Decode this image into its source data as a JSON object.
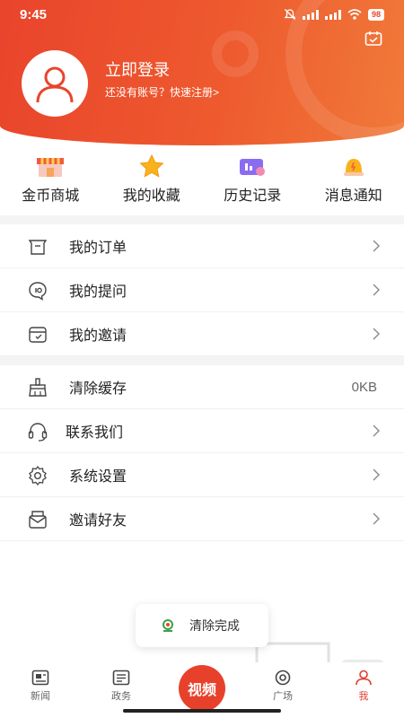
{
  "status_bar": {
    "time": "9:45",
    "battery": "98"
  },
  "profile": {
    "title": "立即登录",
    "subtitle": "还没有账号？快速注册>"
  },
  "quick_menu": [
    {
      "label": "金币商城",
      "icon": "shop-icon"
    },
    {
      "label": "我的收藏",
      "icon": "star-icon"
    },
    {
      "label": "历史记录",
      "icon": "history-icon"
    },
    {
      "label": "消息通知",
      "icon": "bell-icon"
    }
  ],
  "menu_group_1": [
    {
      "label": "我的订单",
      "icon": "order-icon"
    },
    {
      "label": "我的提问",
      "icon": "question-icon"
    },
    {
      "label": "我的邀请",
      "icon": "invite-icon"
    }
  ],
  "menu_group_2": [
    {
      "label": "清除缓存",
      "icon": "broom-icon",
      "value": "0KB"
    },
    {
      "label": "联系我们",
      "icon": "headset-icon"
    },
    {
      "label": "系统设置",
      "icon": "gear-icon"
    },
    {
      "label": "邀请好友",
      "icon": "envelope-icon"
    }
  ],
  "toast": {
    "text": "清除完成"
  },
  "tabbar": {
    "news": "新闻",
    "gov": "政务",
    "video": "视频",
    "square": "广场",
    "me": "我"
  },
  "colors": {
    "brand": "#e9442c",
    "active": "#e23b2b"
  }
}
